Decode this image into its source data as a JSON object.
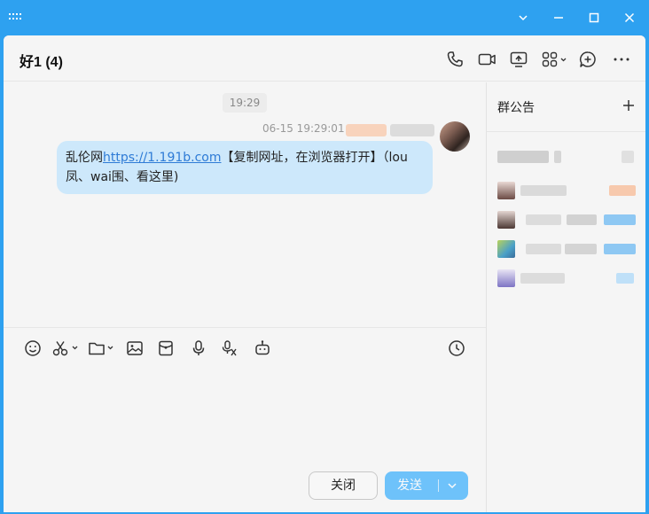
{
  "window": {
    "controls": [
      "chevron-down-icon",
      "minimize-icon",
      "maximize-icon",
      "close-icon"
    ]
  },
  "header": {
    "title": "好1 (4)",
    "actions": [
      "phone-icon",
      "video-call-icon",
      "screen-share-icon",
      "apps-icon",
      "more-chat-icon",
      "more-icon"
    ]
  },
  "chat": {
    "time_divider": "19:29",
    "message": {
      "timestamp": "06-15 19:29:01",
      "text_before": "乱伦网",
      "link": "https://1.191b.com",
      "text_after": "【复制网址，在浏览器打开】（lou凤、wai围、看这里)"
    }
  },
  "sidebar": {
    "title": "群公告",
    "add_icon": "plus-icon"
  },
  "toolbar": {
    "tools": [
      "emoji-icon",
      "scissors-icon",
      "folder-icon",
      "image-icon",
      "red-packet-icon",
      "microphone-icon",
      "voice-to-text-icon",
      "robot-icon",
      "history-clock-icon"
    ]
  },
  "footer": {
    "close_label": "关闭",
    "send_label": "发送"
  },
  "colors": {
    "titlebar": "#2ea1f0",
    "bubble": "#cde8fb",
    "link": "#2e7bd6",
    "send_button": "#0099ff"
  }
}
